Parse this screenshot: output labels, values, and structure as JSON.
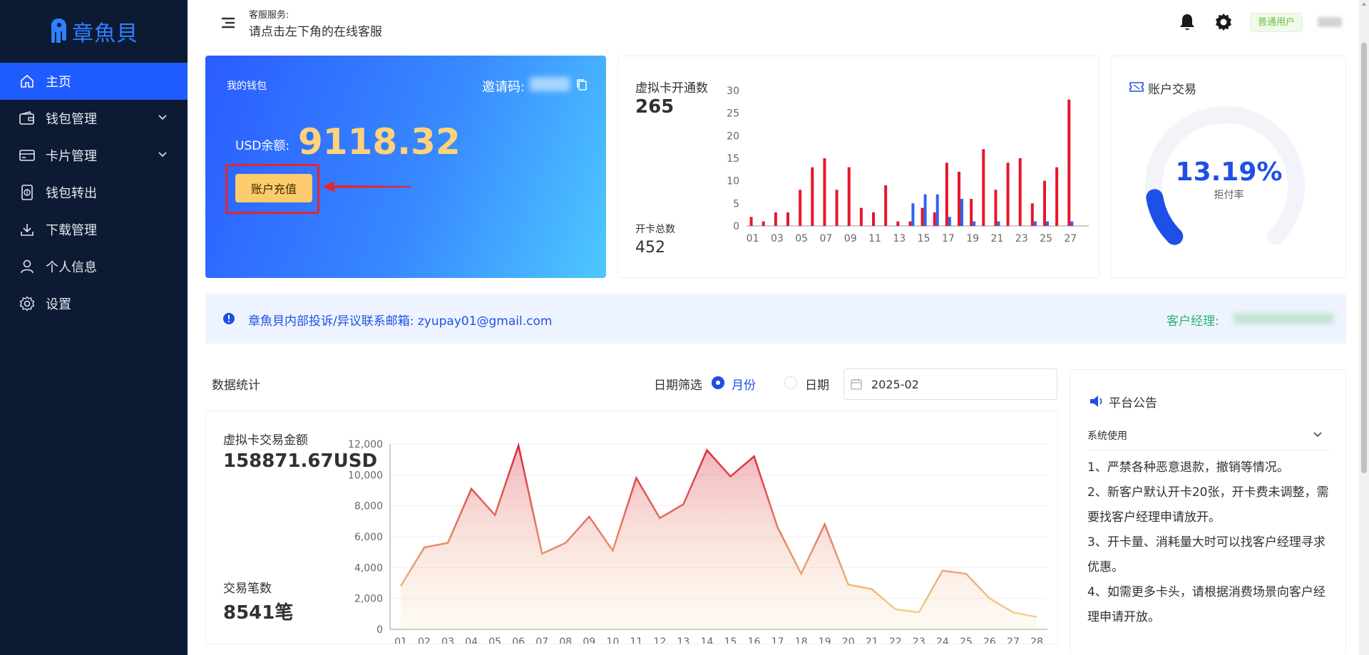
{
  "brand": {
    "name": "章魚貝",
    "color": "#2f80ff"
  },
  "sidebar": {
    "items": [
      {
        "label": "主页",
        "icon": "home-icon",
        "active": true
      },
      {
        "label": "钱包管理",
        "icon": "wallet-icon",
        "expandable": true
      },
      {
        "label": "卡片管理",
        "icon": "card-icon",
        "expandable": true
      },
      {
        "label": "钱包转出",
        "icon": "transfer-icon"
      },
      {
        "label": "下载管理",
        "icon": "download-icon"
      },
      {
        "label": "个人信息",
        "icon": "user-icon"
      },
      {
        "label": "设置",
        "icon": "settings-icon"
      }
    ]
  },
  "header": {
    "service_label": "客服服务:",
    "service_text": "请点击左下角的在线客服",
    "user_role": "普通用户"
  },
  "wallet": {
    "title": "我的钱包",
    "invite_label": "邀请码:",
    "balance_label": "USD余额:",
    "balance": "9118.32",
    "recharge_label": "账户充值"
  },
  "virtual_cards": {
    "title": "虚拟卡开通数",
    "value": "265",
    "sub_label": "开卡总数",
    "sub_value": "452"
  },
  "account_tx": {
    "title": "账户交易",
    "rate": "13.19%",
    "rate_label": "拒付率",
    "rate_value": 0.1319
  },
  "notice": {
    "text": "章魚貝内部投诉/异议联系邮箱: zyupay01@gmail.com",
    "manager_label": "客户经理:"
  },
  "stats": {
    "title": "数据统计",
    "filter_label": "日期筛选",
    "option_month": "月份",
    "option_day": "日期",
    "date_value": "2025-02"
  },
  "amount": {
    "title": "虚拟卡交易金额",
    "value": "158871.67USD",
    "count_label": "交易笔数",
    "count_value": "8541笔"
  },
  "announcement": {
    "title": "平台公告",
    "category": "系统使用",
    "lines": [
      "1、严禁各种恶意退款，撤销等情况。",
      "2、新客户默认开卡20张，开卡费未调整，需要找客户经理申请放开。",
      "3、开卡量、消耗量大时可以找客户经理寻求优惠。",
      "4、如需更多卡头，请根据消费场景向客户经理申请开放。"
    ]
  },
  "chart_data": [
    {
      "type": "bar",
      "categories": [
        "01",
        "02",
        "03",
        "04",
        "05",
        "06",
        "07",
        "08",
        "09",
        "10",
        "11",
        "12",
        "13",
        "14",
        "15",
        "16",
        "17",
        "18",
        "19",
        "20",
        "21",
        "22",
        "23",
        "24",
        "25",
        "26",
        "27",
        "28"
      ],
      "x_tick_labels": [
        "01",
        "03",
        "05",
        "07",
        "09",
        "11",
        "13",
        "15",
        "17",
        "19",
        "21",
        "23",
        "25",
        "27"
      ],
      "series": [
        {
          "color": "#e6162d",
          "values": [
            2,
            1,
            3,
            3,
            8,
            13,
            15,
            8,
            13,
            4,
            3,
            9,
            1,
            1,
            4,
            3,
            14,
            12,
            6,
            17,
            8,
            14,
            15,
            5,
            10,
            13,
            28,
            0
          ]
        },
        {
          "color": "#2f63f0",
          "values": [
            0,
            0,
            0,
            0,
            0,
            0,
            0,
            0,
            0,
            0,
            0,
            0,
            0,
            5,
            7,
            7,
            2,
            6,
            1,
            0,
            1,
            0,
            0,
            1,
            1,
            0,
            1,
            0
          ]
        }
      ],
      "ylim": [
        0,
        30
      ],
      "yticks": [
        0,
        5,
        10,
        15,
        20,
        25,
        30
      ]
    },
    {
      "type": "area",
      "categories": [
        "01",
        "02",
        "03",
        "04",
        "05",
        "06",
        "07",
        "08",
        "09",
        "10",
        "11",
        "12",
        "13",
        "14",
        "15",
        "16",
        "17",
        "18",
        "19",
        "20",
        "21",
        "22",
        "23",
        "24",
        "25",
        "26",
        "27",
        "28"
      ],
      "values": [
        2800,
        5300,
        5600,
        9100,
        7400,
        11900,
        4900,
        5600,
        7300,
        5100,
        9800,
        7200,
        8100,
        11600,
        9900,
        11200,
        6600,
        3600,
        6800,
        2900,
        2600,
        1300,
        1100,
        3800,
        3600,
        2000,
        1100,
        800
      ],
      "ylim": [
        0,
        12000
      ],
      "yticks": [
        "0",
        "2,000",
        "4,000",
        "6,000",
        "8,000",
        "10,000",
        "12,000"
      ],
      "colors": {
        "high": "#d7263d",
        "low": "#f5d28a"
      }
    }
  ]
}
